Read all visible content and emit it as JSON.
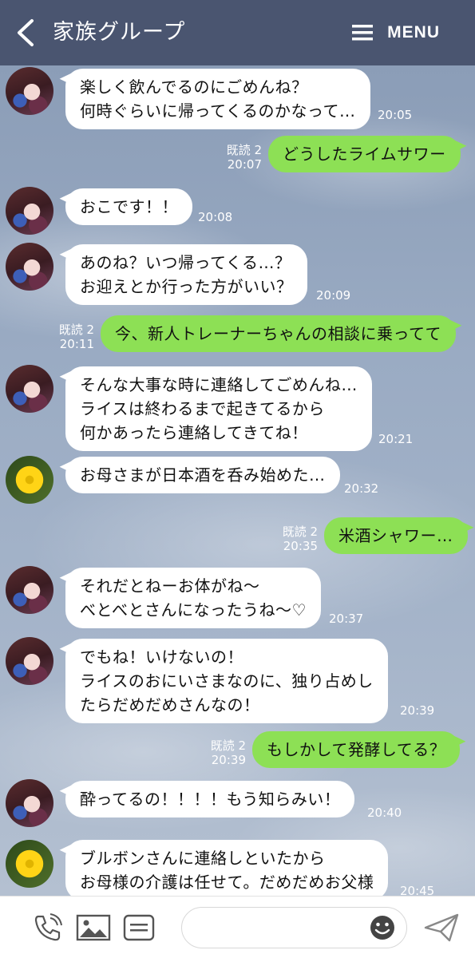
{
  "header": {
    "title": "家族グループ",
    "menu_label": "MENU"
  },
  "input": {
    "placeholder": ""
  },
  "messages": [
    {
      "text": "楽しく飲んでるのにごめんね？\n何時ぐらいに帰ってくるのかなって…",
      "time": "20:05"
    },
    {
      "text": "どうしたライムサワー",
      "read": "既読 2",
      "time": "20:07"
    },
    {
      "text": "おこです！！",
      "time": "20:08"
    },
    {
      "text": "あのね？いつ帰ってくる…？\nお迎えとか行った方がいい？",
      "time": "20:09"
    },
    {
      "text": "今、新人トレーナーちゃんの相談に乗ってて",
      "read": "既読 2",
      "time": "20:11"
    },
    {
      "text": "そんな大事な時に連絡してごめんね…\nライスは終わるまで起きてるから\n何かあったら連絡してきてね！",
      "time": "20:21"
    },
    {
      "text": "お母さまが日本酒を呑み始めた…",
      "time": "20:32"
    },
    {
      "text": "米酒シャワー…",
      "read": "既読 2",
      "time": "20:35"
    },
    {
      "text": "それだとねーお体がね～\nべとべとさんになったうね～♡",
      "time": "20:37"
    },
    {
      "text": "でもね！いけないの！\nライスのおにいさまなのに、独り占めし\nたらだめだめさんなの！",
      "time": "20:39"
    },
    {
      "text": "もしかして発酵してる？",
      "read": "既読 2",
      "time": "20:39"
    },
    {
      "text": "酔ってるの！！！！もう知らみい！",
      "time": "20:40"
    },
    {
      "text": "ブルボンさんに連絡しといたから\nお母様の介護は任せて。だめだめお父様",
      "time": "20:45"
    }
  ]
}
